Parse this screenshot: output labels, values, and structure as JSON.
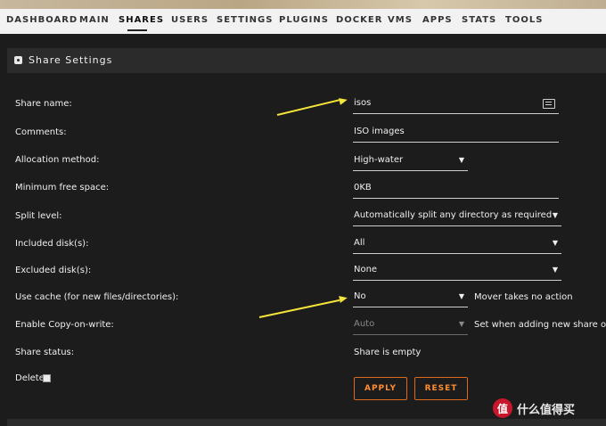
{
  "nav": {
    "items": [
      "DASHBOARD",
      "MAIN",
      "SHARES",
      "USERS",
      "SETTINGS",
      "PLUGINS",
      "DOCKER",
      "VMS",
      "APPS",
      "STATS",
      "TOOLS"
    ],
    "active": "SHARES"
  },
  "panel": {
    "title": "Share Settings",
    "icon": "share-icon"
  },
  "form": {
    "share_name": {
      "label": "Share name:",
      "value": "isos"
    },
    "comments": {
      "label": "Comments:",
      "value": "ISO images"
    },
    "allocation": {
      "label": "Allocation method:",
      "value": "High-water"
    },
    "min_free": {
      "label": "Minimum free space:",
      "value": "0KB"
    },
    "split_level": {
      "label": "Split level:",
      "value": "Automatically split any directory as required"
    },
    "included": {
      "label": "Included disk(s):",
      "value": "All"
    },
    "excluded": {
      "label": "Excluded disk(s):",
      "value": "None"
    },
    "use_cache": {
      "label": "Use cache (for new files/directories):",
      "value": "No",
      "note": "Mover takes no action"
    },
    "cow": {
      "label": "Enable Copy-on-write:",
      "value": "Auto",
      "note": "Set when adding new share only."
    },
    "status": {
      "label": "Share status:",
      "value": "Share is empty"
    },
    "delete": {
      "label": "Delete",
      "checked": false
    }
  },
  "buttons": {
    "apply": "APPLY",
    "reset": "RESET"
  },
  "watermark": {
    "logo": "值",
    "text": "什么值得买"
  },
  "colors": {
    "accent": "#e0681b",
    "annotation_arrow": "#f5e43a"
  }
}
